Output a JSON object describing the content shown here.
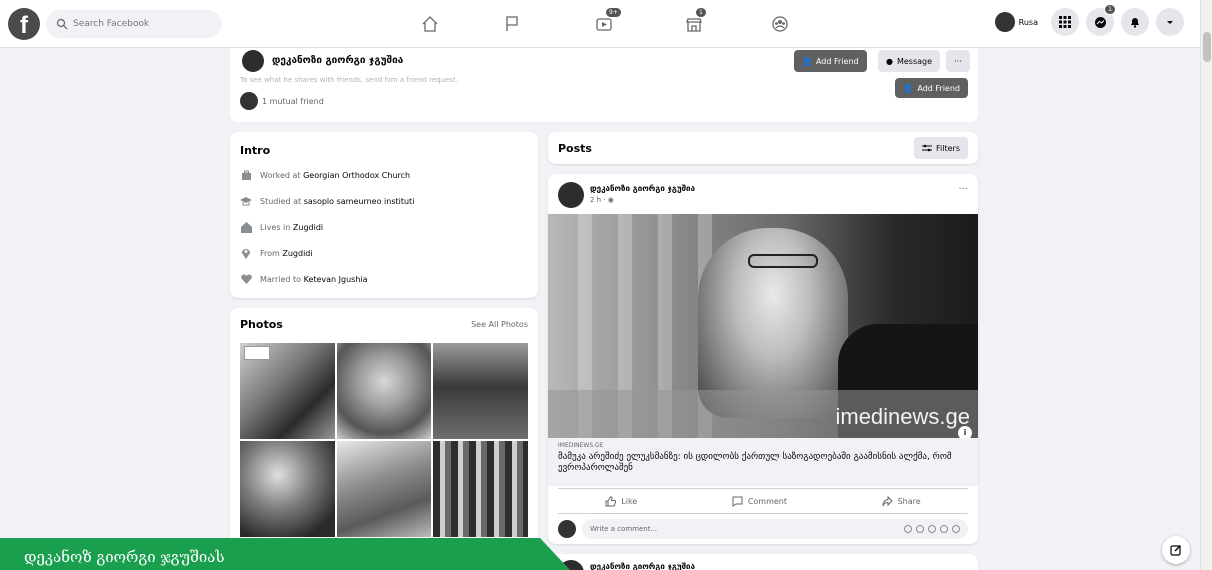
{
  "topbar": {
    "logo": "f",
    "search_placeholder": "Search Facebook",
    "nav": [
      {
        "name": "home",
        "badge": ""
      },
      {
        "name": "pages",
        "badge": ""
      },
      {
        "name": "watch",
        "badge": "9+"
      },
      {
        "name": "marketplace",
        "badge": "1"
      },
      {
        "name": "groups",
        "badge": ""
      }
    ],
    "profile_name": "Rusa",
    "notif_badge": "1"
  },
  "profile_header": {
    "name": "დეკანოზი გიორგი ჯგუშია",
    "add_friend": "Add Friend",
    "message": "Message",
    "more": "···"
  },
  "friend_card": {
    "faded_text": "To see what he shares with friends, send him a friend request.",
    "mutual": "1 mutual friend",
    "add_friend": "Add Friend"
  },
  "intro": {
    "title": "Intro",
    "items": [
      {
        "prefix": "Worked at",
        "value": "Georgian Orthodox Church",
        "icon": "briefcase-icon"
      },
      {
        "prefix": "Studied at",
        "value": "sasoplo sameurneo instituti",
        "icon": "graduation-cap-icon"
      },
      {
        "prefix": "Lives in",
        "value": "Zugdidi",
        "icon": "home-icon"
      },
      {
        "prefix": "From",
        "value": "Zugdidi",
        "icon": "location-pin-icon"
      },
      {
        "prefix": "Married to",
        "value": "Ketevan Jgushia",
        "icon": "heart-icon"
      }
    ]
  },
  "photos": {
    "title": "Photos",
    "see_all": "See All Photos"
  },
  "posts": {
    "title": "Posts",
    "filters": "Filters"
  },
  "post": {
    "author": "დეკანოზი გიორგი ჯგუშია",
    "time": "2 h · ",
    "watermark": "imedinews.ge",
    "link_domain": "IMEDINEWS.GE",
    "link_title": "მამუკა არეშიძე ელუკსმანზე: ის ცდილობს ქართულ საზოგადოებაში გაამისნის ალქმა, რომ ევროპაროლაშენ",
    "like": "Like",
    "comment": "Comment",
    "share": "Share",
    "comment_placeholder": "Write a comment..."
  },
  "post2": {
    "author": "დეკანოზი გიორგი ჯგუშია"
  },
  "overlay_label": "დეკანოზ გიორგი ჯგუშიას",
  "colors": {
    "accent_green": "#1a9f4e",
    "button_dark": "#5f6062",
    "bg": "#f0f2f5"
  }
}
